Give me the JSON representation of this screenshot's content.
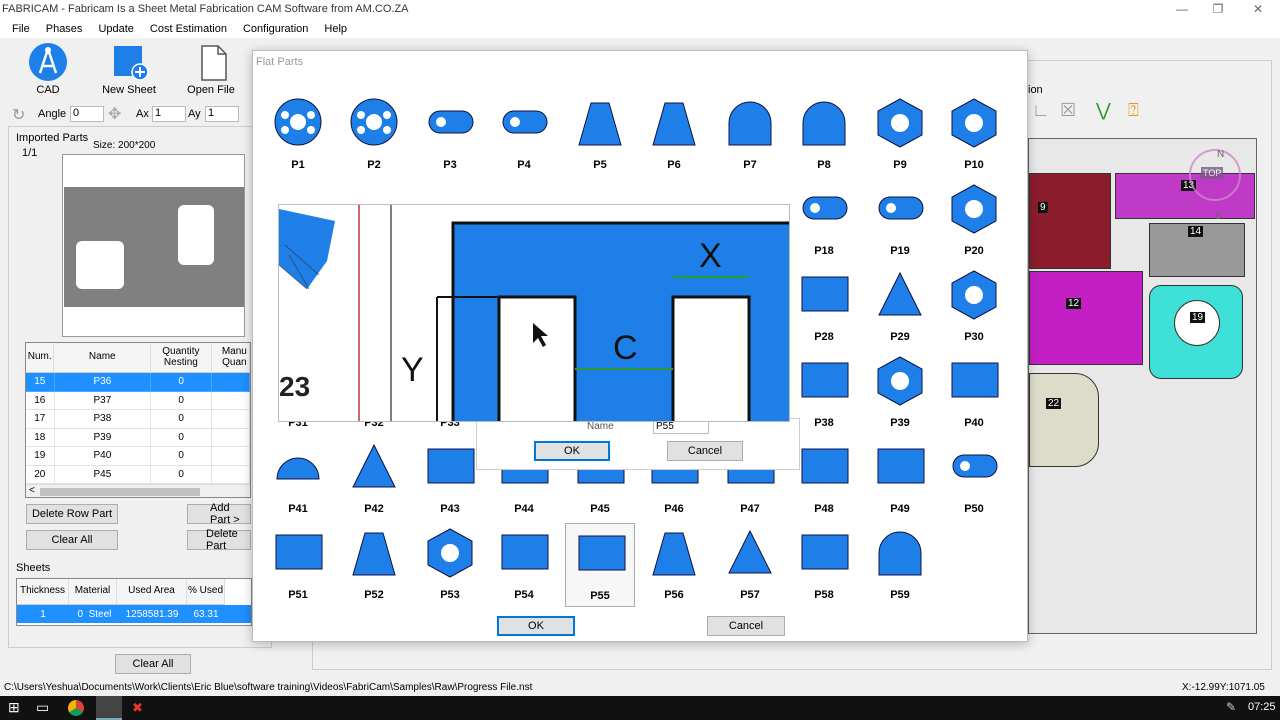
{
  "window": {
    "title": "FABRICAM - Fabricam Is a Sheet Metal Fabrication CAM Software from AM.CO.ZA",
    "minimize": "—",
    "maximize": "❐",
    "close": "✕"
  },
  "menu": [
    "File",
    "Phases",
    "Update",
    "Cost Estimation",
    "Configuration",
    "Help"
  ],
  "toolbar": {
    "cad": "CAD",
    "new_sheet": "New Sheet",
    "open_file": "Open File",
    "angle_label": "Angle",
    "angle_value": "0",
    "ax_label": "Ax",
    "ax_value": "1",
    "ay_label": "Ay",
    "ay_value": "1"
  },
  "imported": {
    "title": "Imported Parts",
    "page": "1/1",
    "size": "Size: 200*200"
  },
  "parts_table": {
    "headers": [
      "Num.",
      "Name",
      "Quantity Nesting",
      "Manu Quan"
    ],
    "rows": [
      {
        "num": "15",
        "name": "P36",
        "qty": "0"
      },
      {
        "num": "16",
        "name": "P37",
        "qty": "0"
      },
      {
        "num": "17",
        "name": "P38",
        "qty": "0"
      },
      {
        "num": "18",
        "name": "P39",
        "qty": "0"
      },
      {
        "num": "19",
        "name": "P40",
        "qty": "0"
      },
      {
        "num": "20",
        "name": "P45",
        "qty": "0"
      }
    ]
  },
  "buttons": {
    "delete_row": "Delete Row Part",
    "add_part": "Add Part >",
    "clear_all": "Clear All",
    "delete_part": "Delete Part",
    "clear_all2": "Clear All"
  },
  "sheets": {
    "title": "Sheets",
    "headers": [
      "Thickness",
      "Material",
      "Used Area",
      "% Used"
    ],
    "row": {
      "thickness": "1",
      "mat_id": "0",
      "material": "Steel",
      "area": "1258581.39",
      "used": "63.31"
    }
  },
  "dialog": {
    "title": "Flat Parts",
    "parts": [
      "P1",
      "P2",
      "P3",
      "P4",
      "P5",
      "P6",
      "P7",
      "P8",
      "P9",
      "P10",
      "P18",
      "P19",
      "P20",
      "P28",
      "P29",
      "P30",
      "P31",
      "P32",
      "P33",
      "P38",
      "P39",
      "P40",
      "P41",
      "P42",
      "P43",
      "P44",
      "P45",
      "P46",
      "P47",
      "P48",
      "P49",
      "P50",
      "P51",
      "P52",
      "P53",
      "P54",
      "P55",
      "P56",
      "P57",
      "P58",
      "P59"
    ],
    "ok": "OK",
    "cancel": "Cancel"
  },
  "popup": {
    "name_label": "Name",
    "name_value": "P55",
    "ok": "OK",
    "cancel": "Cancel",
    "x": "X",
    "y": "Y",
    "c": "C",
    "num": "23"
  },
  "canvas": {
    "labels": [
      "9",
      "13",
      "14",
      "12",
      "19",
      "22"
    ],
    "compass": "TOP",
    "n": "N",
    "s": "S",
    "partial": "ion"
  },
  "status": {
    "path": "C:\\Users\\Yeshua\\Documents\\Work\\Clients\\Eric Blue\\software training\\Videos\\FabriCam\\Samples\\Raw\\Progress File.nst",
    "coords": "X:-12.99Y:1071.05"
  },
  "taskbar": {
    "time": "07:25"
  },
  "colors": {
    "part_blue": "#1e7fe8",
    "selection": "#1e90ff",
    "dark_red": "#8b1c2c",
    "magenta": "#c03ac8",
    "cyan": "#3ee0d8"
  }
}
